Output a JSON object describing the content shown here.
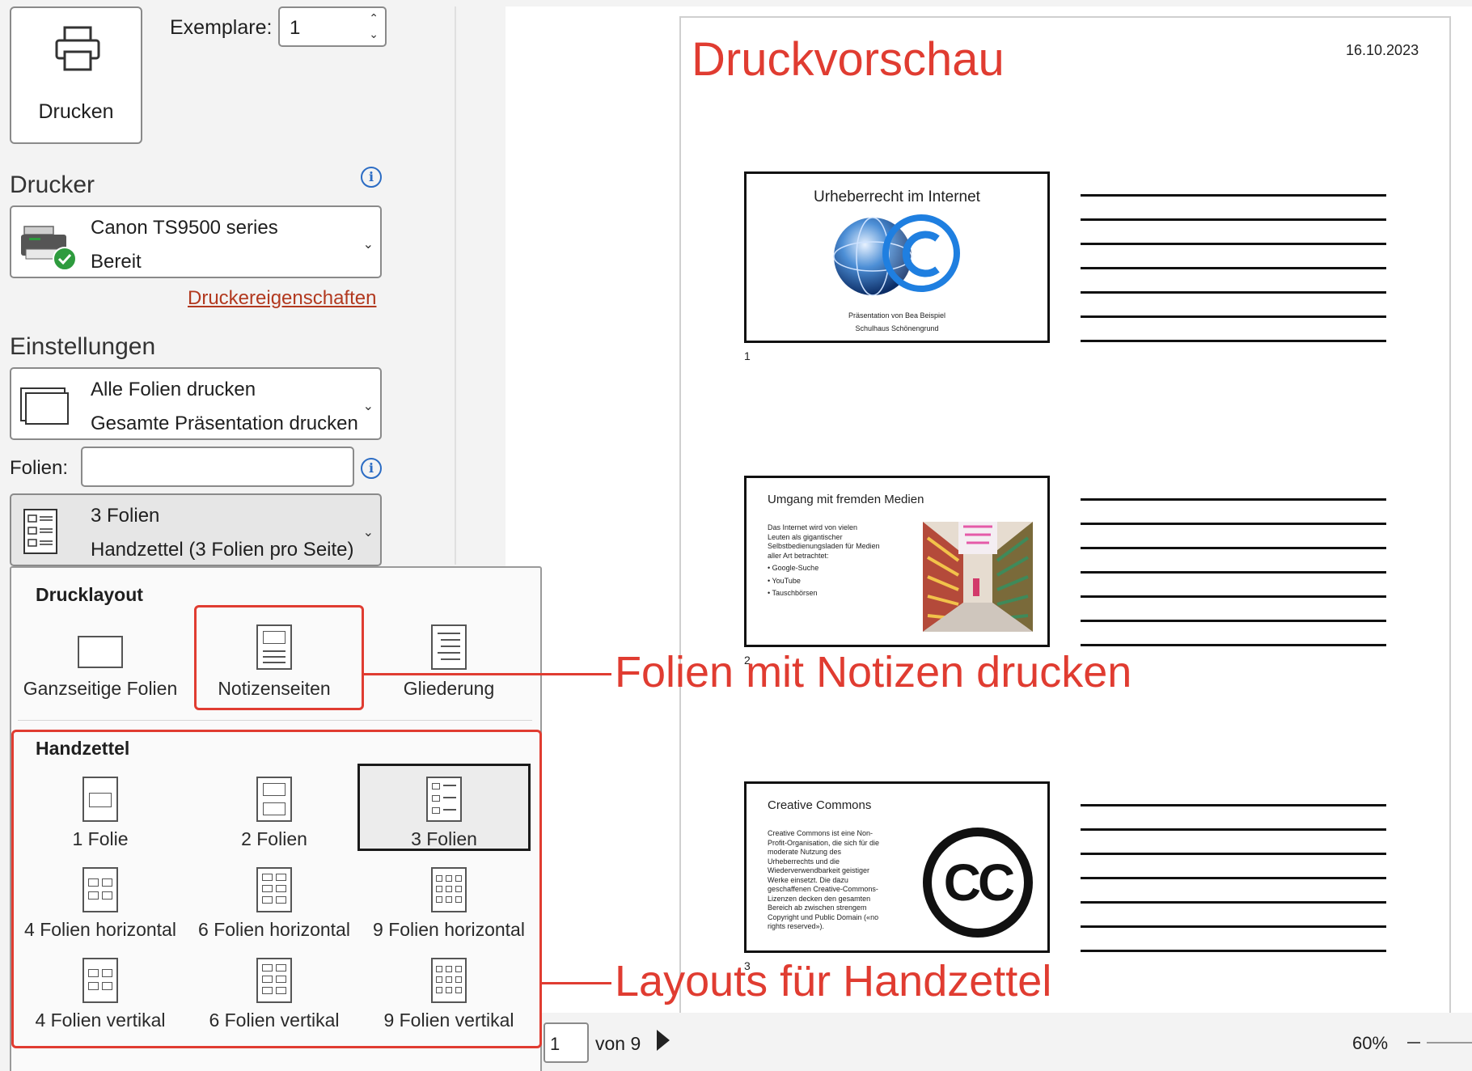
{
  "print": {
    "button_label": "Drucken",
    "copies_label": "Exemplare:",
    "copies_value": "1"
  },
  "printer": {
    "section_title": "Drucker",
    "name": "Canon TS9500 series",
    "status": "Bereit",
    "properties_link": "Druckereigenschaften"
  },
  "settings": {
    "section_title": "Einstellungen",
    "range": {
      "line1": "Alle Folien drucken",
      "line2": "Gesamte Präsentation drucken"
    },
    "slides_label": "Folien:",
    "slides_value": "",
    "layout": {
      "line1": "3 Folien",
      "line2": "Handzettel (3 Folien pro Seite)"
    }
  },
  "flyout": {
    "print_layout_title": "Drucklayout",
    "print_layouts": [
      "Ganzseitige Folien",
      "Notizenseiten",
      "Gliederung"
    ],
    "handouts_title": "Handzettel",
    "handouts": [
      "1 Folie",
      "2 Folien",
      "3 Folien",
      "4 Folien horizontal",
      "6 Folien horizontal",
      "9 Folien horizontal",
      "4 Folien vertikal",
      "6 Folien vertikal",
      "9 Folien vertikal"
    ]
  },
  "preview": {
    "title": "Druckvorschau",
    "date": "16.10.2023",
    "slides": [
      {
        "number": "1",
        "title": "Urheberrecht im Internet",
        "sub1": "Präsentation von Bea Beispiel",
        "sub2": "Schulhaus Schönengrund"
      },
      {
        "number": "2",
        "title": "Umgang mit fremden Medien",
        "body": [
          "Das Internet wird von vielen",
          "Leuten als gigantischer",
          "Selbstbedienungsladen für Medien",
          "aller Art betrachtet:"
        ],
        "bullets": [
          "Google-Suche",
          "YouTube",
          "Tauschbörsen"
        ]
      },
      {
        "number": "3",
        "title": "Creative Commons",
        "body": [
          "Creative Commons ist eine Non-",
          "Profit-Organisation, die sich für die",
          "moderate Nutzung des",
          "Urheberrechts und die",
          "Wiederverwendbarkeit geistiger",
          "Werke einsetzt. Die dazu",
          "geschaffenen Creative-Commons-",
          "Lizenzen decken den gesamten",
          "Bereich ab zwischen strengem",
          "Copyright und Public Domain («no",
          "rights reserved»)."
        ],
        "logo_text": "CC"
      }
    ]
  },
  "navigation": {
    "current_page": "1",
    "of_label": "von 9",
    "zoom": "60%"
  },
  "annotations": {
    "notes": "Folien mit Notizen drucken",
    "handouts": "Layouts für Handzettel"
  },
  "colors": {
    "accent_red": "#e03c31",
    "link": "#b2391f",
    "info_blue": "#2b6cc4",
    "check_green": "#2e9b3e"
  }
}
